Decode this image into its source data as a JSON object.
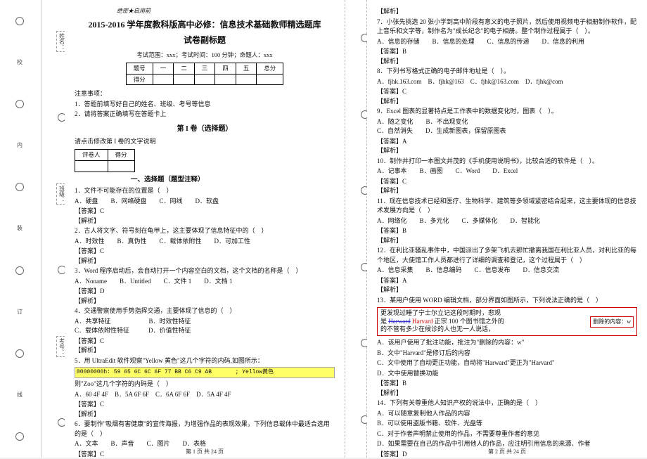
{
  "header": {
    "secret": "绝密★启用前",
    "title": "2015-2016 学年度教科版高中必修：信息技术基础教师精选题库",
    "subtitle": "试卷副标题",
    "meta": "考试范围：xxx；考试时间：100 分钟；命题人：xxx"
  },
  "score_table": {
    "row_labels": [
      "题号",
      "得分"
    ],
    "cols": [
      "一",
      "二",
      "三",
      "四",
      "五",
      "总分"
    ]
  },
  "notice": {
    "heading": "注意事项：",
    "items": [
      "1．答题前填写好自己的姓名、班级、考号等信息",
      "2．请将答案正确填写在答题卡上"
    ]
  },
  "section1": {
    "heading": "第 I 卷（选择题）",
    "instruction": "请点击修改第 I 卷的文字说明"
  },
  "review_table": {
    "c1": "评卷人",
    "c2": "得分"
  },
  "qtype_heading": "一、选择题（题型注释）",
  "questions_left": [
    {
      "stem": "1．文件不可能存在的位置是（　）",
      "opts": "A．硬盘　　B．网络硬盘　　C．网线　　D．软盘",
      "ans": "【答案】C",
      "exp": "【解析】"
    },
    {
      "stem": "2．古人将文字、符号刻在龟甲上，这主要体现了信息特征中的（　）",
      "opts": "A．时效性　　B．真伪性　　C．载体依附性　　D．可加工性",
      "ans": "【答案】C",
      "exp": "【解析】"
    },
    {
      "stem": "3．Word 程序启动后，会自动打开一个内容空白的文档，这个文档的名称是（　）",
      "opts": "A．Noname　　B．Untitled　　C．文件 1　　D．文档 1",
      "ans": "【答案】D",
      "exp": "【解析】"
    },
    {
      "stem": "4．交通警察使用手势指挥交通，主要体现了信息的（　）",
      "opts": "A．共享特征　　　　　　B．时效性特征\nC．载体依附性特征　　　D．价值性特征",
      "ans": "【答案】C",
      "exp": "【解析】"
    }
  ],
  "q5": {
    "stem": "5．用 UltraEdit 软件观察\"Yellow 黄色\"这几个字符的内码,如图所示：",
    "hex": "00000000h: 59 65 6C 6C 6F 77 BB C6 C9 AB       ; Yellow黄色",
    "follow": "则\"Zoo\"这几个字符的内码是（　）",
    "opts": "A．60 4F 4F　B．5A 6F 6F　C．6A 6F 6F　D．5A 4F 4F",
    "ans": "【答案】C",
    "exp": "【解析】"
  },
  "q6": {
    "stem": "6．要制作\"吸烟有害健康\"的宣传海报，为增强作品的表现效果，下列信息载体中最适合选用的是（　）",
    "opts": "A．文本　　B．声音　　C．图片　　D．表格",
    "ans": "【答案】C",
    "exp": ""
  },
  "questions_right": [
    {
      "pre": "【解析】",
      "stem": "7．小张先挑选 20 张小学到高中阶段有意义的电子照片，然后使用视频电子相册制作软件，配上音乐和文字等，制作名为\"成长纪念\"的电子相册。整个制作过程属于（　）。",
      "opts": "A．信息的存储　　B．信息的处理　　C．信息的传递　　D．信息的利用",
      "ans": "【答案】B",
      "exp": "【解析】"
    },
    {
      "stem": "8．下列书写格式正确的电子邮件地址是（　）。",
      "opts": "A．fjhk.163.com　B．fjhk@163　C．fjhk@163.com　D．fjhk@com",
      "ans": "【答案】C",
      "exp": "【解析】"
    },
    {
      "stem": "9．Excel 图表的显著特点是工作表中的数据变化时，图表（　）。",
      "opts": "A．随之变化　　B．不出现变化\nC．自然消失　　D．生成新图表，保留原图表",
      "ans": "【答案】A",
      "exp": "【解析】"
    },
    {
      "stem": "10．制作并打印一本图文并茂的《手机使用说明书》，比较合适的软件是（　）。",
      "opts": "A．记事本　　B．画图　　C．Word　　D．Excel",
      "ans": "【答案】C",
      "exp": "【解析】"
    },
    {
      "stem": "11．现在信息技术已经和医疗、生物科学、建筑等多领域紧密结合起来，这主要体现的信息技术发展方向是（　）",
      "opts": "A．网络化　　B．多元化　　C．多媒体化　　D．智能化",
      "ans": "【答案】B",
      "exp": "【解析】"
    },
    {
      "stem": "12．在利比亚骚乱事件中，中国派出了多架飞机去那忙撤离我国在利比亚人员，对利比亚的每个地区，大使馆工作人员都进行了详细的调查和登记，这个过程属于（　）",
      "opts": "A．信息采集　　B．信息编码　　C．信息发布　　D．信息交流",
      "ans": "【答案】A",
      "exp": "【解析】"
    }
  ],
  "q13": {
    "stem": "13．某用户使用 WORD 编辑文档，部分界面如图所示，下列说法正确的是（　）",
    "track_left_l1": "更发现过睡了宁士尔立记这段时期时，悲观",
    "track_left_l2_a": "是 ",
    "track_left_l2_del": "Harward",
    "track_left_l2_ins": "Harvard",
    "track_left_l2_b": " 正宗 100 个图书馆之外的",
    "track_left_l3": "的不管有多少在候诊的人也无一人说话，",
    "track_right": "删除的内容：w",
    "opts": [
      "A．该用户使用了批注功能，批注为\"删除的内容：w\"",
      "B．文中\"Harvard\"是修订后的内容",
      "C．文中使用了自动更正功能，自动将\"Harward\"更正为\"Harvard\"",
      "D．文中使用替换功能"
    ],
    "ans": "【答案】B",
    "exp": "【解析】"
  },
  "q14": {
    "stem": "14．下列有关尊重他人知识产权的说法中，正确的是（　）",
    "opts": [
      "A．可以随意复制他人作品的内容",
      "B．可以使用盗版书籍、软件、光盘等",
      "C．对于作者声明禁止使用的作品，不需要尊重作者的意见",
      "D．如果需要在自己的作品中引用他人的作品，应注明引用信息的来源、作者"
    ],
    "ans": "【答案】D"
  },
  "gutter_labels": {
    "a": "校",
    "b": "内",
    "c": "装",
    "d": "订",
    "e": "线",
    "name": "姓名：",
    "class": "班级：",
    "examno": "考号："
  },
  "footer": {
    "left": "第 1 页 共 24 页",
    "right": "第 2 页 共 24 页"
  }
}
